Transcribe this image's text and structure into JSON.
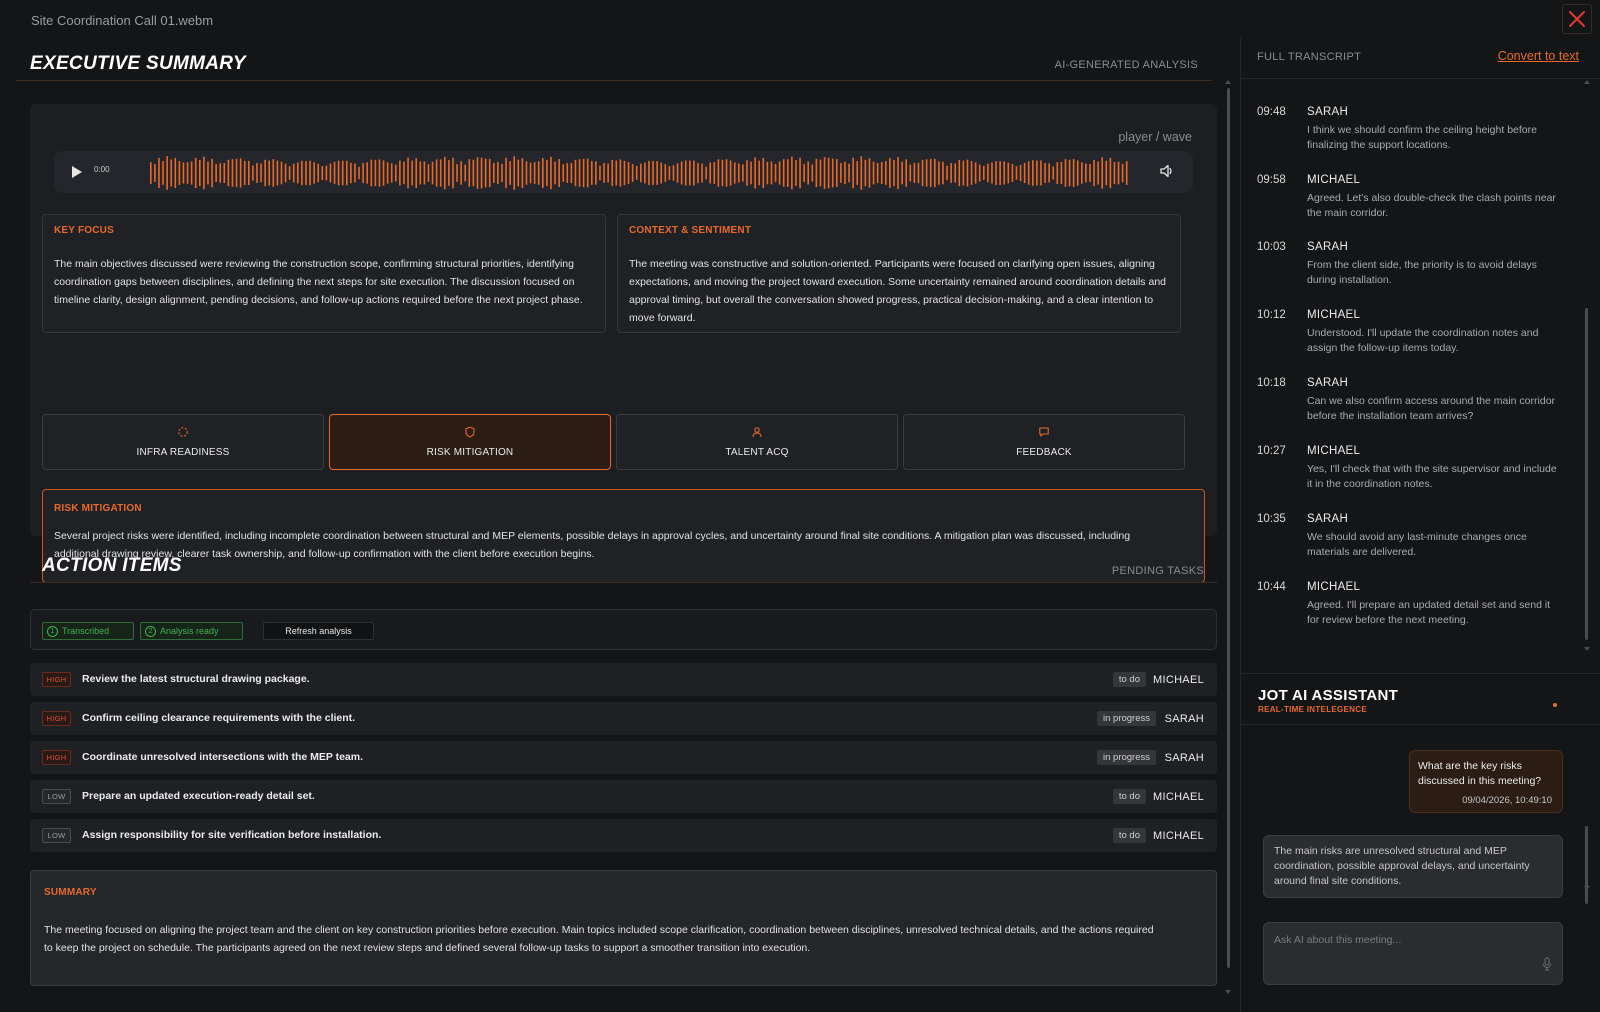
{
  "window": {
    "title": "Site Coordination Call 01.webm"
  },
  "executive_summary": {
    "title": "EXECUTIVE SUMMARY",
    "subtitle": "AI-GENERATED ANALYSIS",
    "player": {
      "label": "player / wave",
      "time": "0:00"
    },
    "key_focus": {
      "label": "KEY FOCUS",
      "text": "The main objectives discussed were reviewing the construction scope, confirming structural priorities, identifying coordination gaps between disciplines, and defining the next steps for site execution. The discussion focused on timeline clarity, design alignment, pending decisions, and follow-up actions required before the next project phase."
    },
    "context": {
      "label": "CONTEXT & SENTIMENT",
      "text": "The meeting was constructive and solution-oriented. Participants were focused on clarifying open issues, aligning expectations, and moving the project toward execution. Some uncertainty remained around coordination details and approval timing, but overall the conversation showed progress, practical decision-making, and a clear intention to move forward."
    },
    "tabs": [
      {
        "label": "INFRA READINESS",
        "icon": "loader-icon"
      },
      {
        "label": "RISK MITIGATION",
        "icon": "shield-icon"
      },
      {
        "label": "TALENT ACQ",
        "icon": "person-icon"
      },
      {
        "label": "FEEDBACK",
        "icon": "chat-icon"
      }
    ],
    "active_tab": "RISK MITIGATION",
    "risk": {
      "label": "RISK MITIGATION",
      "text": "Several project risks were identified, including incomplete coordination between structural and MEP elements, possible delays in approval cycles, and uncertainty around final site conditions. A mitigation plan was discussed, including additional drawing review, clearer task ownership, and follow-up confirmation with the client before execution begins."
    }
  },
  "action_items": {
    "title": "ACTION ITEMS",
    "subtitle": "PENDING TASKS",
    "status": [
      {
        "num": "1",
        "label": "Transcribed"
      },
      {
        "num": "2",
        "label": "Analysis ready"
      }
    ],
    "refresh_label": "Refresh analysis",
    "tasks": [
      {
        "priority": "HIGH",
        "text": "Review the latest structural drawing package.",
        "status": "to do",
        "owner": "MICHAEL"
      },
      {
        "priority": "HIGH",
        "text": "Confirm ceiling clearance requirements with the client.",
        "status": "in progress",
        "owner": "SARAH"
      },
      {
        "priority": "HIGH",
        "text": "Coordinate unresolved intersections with the MEP team.",
        "status": "in progress",
        "owner": "SARAH"
      },
      {
        "priority": "LOW",
        "text": "Prepare an updated execution-ready detail set.",
        "status": "to do",
        "owner": "MICHAEL"
      },
      {
        "priority": "LOW",
        "text": "Assign responsibility for site verification before installation.",
        "status": "to do",
        "owner": "MICHAEL"
      }
    ]
  },
  "summary": {
    "label": "SUMMARY",
    "text": "The meeting focused on aligning the project team and the client on key construction priorities before execution. Main topics included scope clarification, coordination between disciplines, unresolved technical details, and the actions required to keep the project on schedule. The participants agreed on the next review steps and defined several follow-up tasks to support a smoother transition into execution."
  },
  "transcript": {
    "label": "FULL TRANSCRIPT",
    "convert_label": "Convert to text",
    "entries": [
      {
        "time": "09:48",
        "speaker": "SARAH",
        "text": "I think we should confirm the ceiling height before finalizing the support locations."
      },
      {
        "time": "09:58",
        "speaker": "MICHAEL",
        "text": "Agreed. Let's also double-check the clash points near the main corridor."
      },
      {
        "time": "10:03",
        "speaker": "SARAH",
        "text": "From the client side, the priority is to avoid delays during installation."
      },
      {
        "time": "10:12",
        "speaker": "MICHAEL",
        "text": "Understood. I'll update the coordination notes and assign the follow-up items today."
      },
      {
        "time": "10:18",
        "speaker": "SARAH",
        "text": "Can we also confirm access around the main corridor before the installation team arrives?"
      },
      {
        "time": "10:27",
        "speaker": "MICHAEL",
        "text": "Yes, I'll check that with the site supervisor and include it in the coordination notes."
      },
      {
        "time": "10:35",
        "speaker": "SARAH",
        "text": "We should avoid any last-minute changes once materials are delivered."
      },
      {
        "time": "10:44",
        "speaker": "MICHAEL",
        "text": "Agreed. I'll prepare an updated detail set and send it for review before the next meeting."
      }
    ]
  },
  "assistant": {
    "title": "JOT AI ASSISTANT",
    "subtitle": "REAL-TIME INTELEGENCE",
    "user_message": {
      "text": "What are the key risks discussed in this meeting?",
      "timestamp": "09/04/2026, 10:49:10"
    },
    "ai_message": {
      "text": "The main risks are unresolved structural and MEP coordination, possible approval delays, and uncertainty around final site conditions."
    },
    "input_placeholder": "Ask AI about this meeting..."
  },
  "colors": {
    "accent": "#e8692a",
    "background": "#141517",
    "card": "#1f2125",
    "success": "#3fb34f"
  }
}
